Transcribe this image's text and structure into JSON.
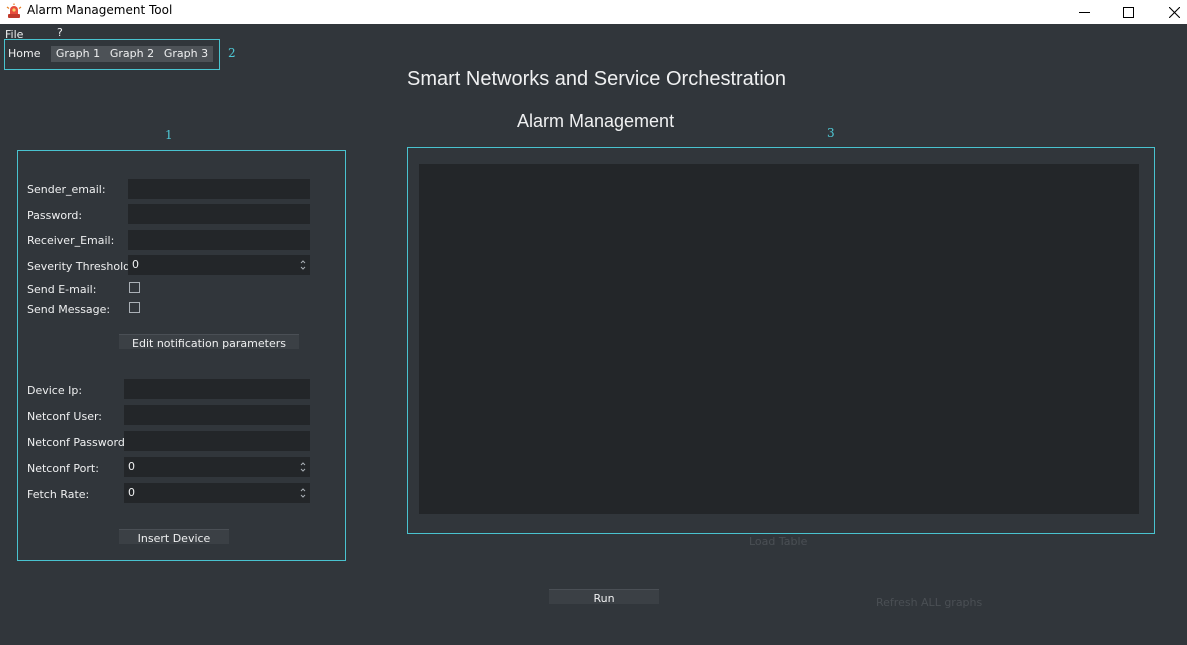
{
  "window": {
    "title": "Alarm Management Tool",
    "icon": "alarm-icon"
  },
  "menu": {
    "items": [
      "File",
      "?"
    ]
  },
  "annotations": {
    "left_panel": "1",
    "tabs": "2",
    "table": "3"
  },
  "tabs": [
    {
      "label": "Home",
      "selected": true
    },
    {
      "label": "Graph 1"
    },
    {
      "label": "Graph 2"
    },
    {
      "label": "Graph 3"
    }
  ],
  "headings": {
    "main": "Smart Networks and Service Orchestration",
    "sub": "Alarm Management"
  },
  "notification_form": {
    "sender_email_label": "Sender_email:",
    "sender_email_value": "",
    "password_label": "Password:",
    "password_value": "",
    "receiver_email_label": "Receiver_Email:",
    "receiver_email_value": "",
    "severity_label": "Severity Threshold:",
    "severity_value": "0",
    "send_email_label": "Send E-mail:",
    "send_email_checked": false,
    "send_message_label": "Send Message:",
    "send_message_checked": false,
    "edit_button": "Edit notification parameters"
  },
  "device_form": {
    "device_ip_label": "Device Ip:",
    "device_ip_value": "",
    "netconf_user_label": "Netconf User:",
    "netconf_user_value": "",
    "netconf_password_label": "Netconf Password:",
    "netconf_password_value": "",
    "netconf_port_label": "Netconf Port:",
    "netconf_port_value": "0",
    "fetch_rate_label": "Fetch Rate:",
    "fetch_rate_value": "0",
    "insert_button": "Insert Device"
  },
  "actions": {
    "load_table": "Load Table",
    "run": "Run",
    "refresh_all": "Refresh ALL graphs"
  },
  "colors": {
    "background": "#31363b",
    "field": "#232629",
    "annotation": "#4fc9d6"
  }
}
